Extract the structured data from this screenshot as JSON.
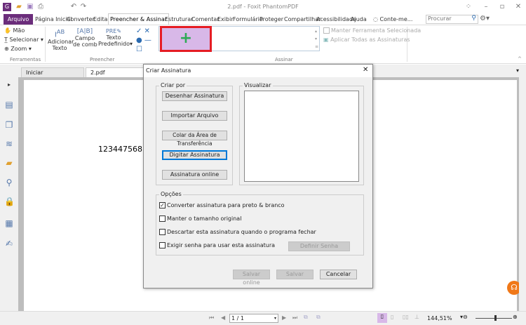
{
  "window": {
    "title": "2.pdf - Foxit PhantomPDF"
  },
  "menu": {
    "file": "Arquivo",
    "tabs": [
      "Página Inicial",
      "Converter",
      "Editar",
      "Preencher & Assinar",
      "Estruturar",
      "Comentar",
      "Exibir",
      "Formulário",
      "Proteger",
      "Compartilhar",
      "Acessibilidade",
      "Ajuda"
    ],
    "active": "Preencher & Assinar",
    "tell_me": "Conte-me...",
    "search_placeholder": "Procurar"
  },
  "ribbon": {
    "tools": {
      "items": [
        "Mão",
        "Selecionar",
        "Zoom"
      ],
      "group": "Ferramentas"
    },
    "fill": {
      "items": [
        "Adicionar Texto",
        "Campo de comb",
        "Texto Predefinido"
      ],
      "add_text": [
        "Adicionar",
        "Texto"
      ],
      "comb": [
        "Campo",
        "de comb"
      ],
      "predef": [
        "Texto",
        "Predefinido"
      ],
      "group": "Preencher"
    },
    "sign": {
      "keep_tool": "Manter Ferramenta Selecionada",
      "apply_all": "Aplicar Todas as Assinaturas",
      "group": "Assinar",
      "add_icon": "+"
    },
    "accent": "#d8b8e8"
  },
  "doc_tabs": [
    "Iniciar",
    "2.pdf"
  ],
  "document": {
    "text": "123447568"
  },
  "dialog": {
    "title": "Criar Assinatura",
    "create_by": "Criar por",
    "buttons": [
      "Desenhar Assinatura",
      "Importar Arquivo",
      "Colar da Área de Transferência",
      "Digitar Assinatura",
      "Assinatura online"
    ],
    "preview": "Visualizar",
    "options_label": "Opções",
    "options": [
      {
        "label": "Converter assinatura para preto & branco",
        "checked": true
      },
      {
        "label": "Manter o tamanho original",
        "checked": false
      },
      {
        "label": "Descartar esta assinatura quando o programa fechar",
        "checked": false
      },
      {
        "label": "Exigir senha para usar esta assinatura",
        "checked": false
      }
    ],
    "set_password": "Definir Senha",
    "save_online": "Salvar online",
    "save": "Salvar",
    "cancel": "Cancelar",
    "check": "✓"
  },
  "status": {
    "page": "1 / 1",
    "zoom": "144,51%"
  }
}
